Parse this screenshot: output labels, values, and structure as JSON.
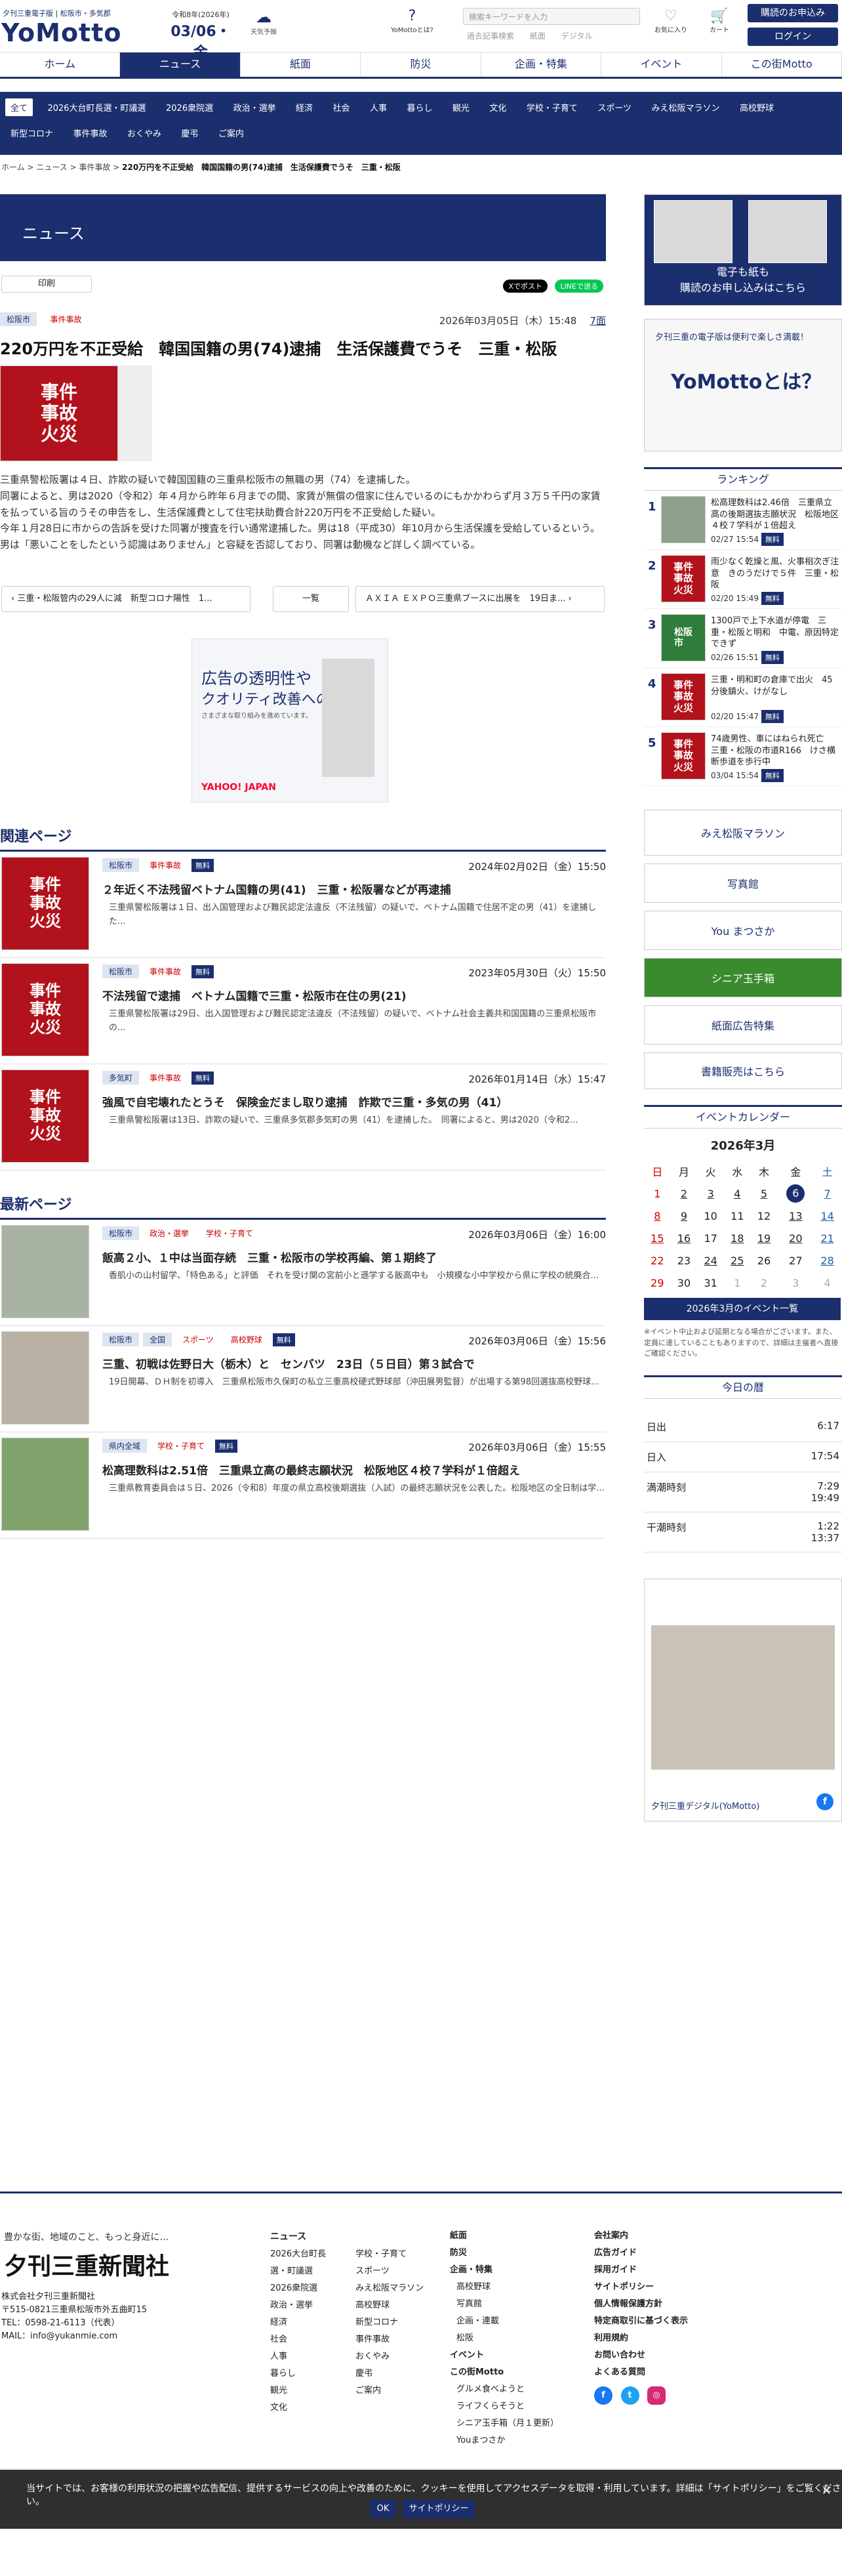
{
  "header": {
    "logo_tagline": "夕刊三重電子版 | 松阪市・多気郡",
    "logo": "YoMotto",
    "date_era": "令和8年(2026年)",
    "date_main": "03/06・金",
    "weather_label": "天気予報",
    "what_label": "YoMottoとは?",
    "search_placeholder": "検索キーワードを入力",
    "search_links": [
      "過去記事検索",
      "紙面",
      "デジタル"
    ],
    "favorites_label": "お気に入り",
    "cart_label": "カート",
    "subscribe_btn": "購読のお申込み",
    "login_btn": "ログイン"
  },
  "mainnav": [
    "ホーム",
    "ニュース",
    "紙面",
    "防災",
    "企画・特集",
    "イベント",
    "この街Motto"
  ],
  "subnav": [
    "全て",
    "2026大台町長選・町議選",
    "2026衆院選",
    "政治・選挙",
    "経済",
    "社会",
    "人事",
    "暮らし",
    "観光",
    "文化",
    "学校・子育て",
    "スポーツ",
    "みえ松阪マラソン",
    "高校野球",
    "新型コロナ",
    "事件事故",
    "おくやみ",
    "慶弔",
    "ご案内"
  ],
  "breadcrumb": {
    "items": [
      "ホーム",
      "ニュース",
      "事件事故"
    ],
    "current": "220万円を不正受給　韓国国籍の男(74)逮捕　生活保護費でうそ　三重・松阪"
  },
  "section_title": "ニュース",
  "print_label": "印刷",
  "share": {
    "x": "Xでポスト",
    "line": "LINEで送る"
  },
  "article": {
    "area_tag": "松阪市",
    "cat_tag": "事件事故",
    "date": "2026年03月05日（木）15:48",
    "page": "7面",
    "title": "220万円を不正受給　韓国国籍の男(74)逮捕　生活保護費でうそ　三重・松阪",
    "thumb_text": "事件\n事故\n火災",
    "body": [
      "三重県警松阪署は４日、詐欺の疑いで韓国国籍の三重県松阪市の無職の男（74）を逮捕した。",
      "同署によると、男は2020（令和2）年４月から昨年６月までの間、家賃が無償の借家に住んでいるのにもかかわらず月３万５千円の家賃を払っている旨のうその申告をし、生活保護費として住宅扶助費合計220万円を不正受給した疑い。",
      "今年１月28日に市からの告訴を受けた同署が捜査を行い通常逮捕した。男は18（平成30）年10月から生活保護を受給しているという。",
      "男は「悪いことをしたという認識はありません」と容疑を否認しており、同署は動機など詳しく調べている。"
    ]
  },
  "pager": {
    "prev": "三重・松阪管内の29人に減　新型コロナ陽性　1...",
    "list": "一覧",
    "next": "ＡＸＩＡ ＥＸＰＯ三重県ブースに出展を　19日ま..."
  },
  "ad": {
    "line1": "広告の透明性や",
    "line2": "クオリティ改善への",
    "line3": "さまざまな取り組みを進めています。",
    "brand": "YAHOO! JAPAN"
  },
  "related": {
    "heading": "関連ページ",
    "items": [
      {
        "area": "松阪市",
        "cat": "事件事故",
        "free": "無料",
        "date": "2024年02月02日（金）15:50",
        "title": "２年近く不法残留ベトナム国籍の男(41)　三重・松阪署などが再逮捕",
        "excerpt": "三重県警松阪署は１日、出入国管理および難民認定法違反（不法残留）の疑いで、ベトナム国籍で住居不定の男（41）を逮捕した..."
      },
      {
        "area": "松阪市",
        "cat": "事件事故",
        "free": "無料",
        "date": "2023年05月30日（火）15:50",
        "title": "不法残留で逮捕　ベトナム国籍で三重・松阪市在住の男(21)",
        "excerpt": "三重県警松阪署は29日、出入国管理および難民認定法違反（不法残留）の疑いで、ベトナム社会主義共和国国籍の三重県松阪市の..."
      },
      {
        "area": "多気町",
        "cat": "事件事故",
        "free": "無料",
        "date": "2026年01月14日（水）15:47",
        "title": "強風で自宅壊れたとうそ　保険金だまし取り逮捕　詐欺で三重・多気の男（41）",
        "excerpt": "三重県警松阪署は13日、詐欺の疑いで、三重県多気郡多気町の男（41）を逮捕した。　同署によると、男は2020（令和2..."
      }
    ]
  },
  "latest": {
    "heading": "最新ページ",
    "items": [
      {
        "tags": [
          "松阪市",
          "政治・選挙",
          "学校・子育て"
        ],
        "free": "",
        "date": "2026年03月06日（金）16:00",
        "title": "飯高２小、１中は当面存続　三重・松阪市の学校再編、第１期終了",
        "excerpt": "香肌小の山村留学、「特色ある」と評価　それを受け関の宮前小と遜学する飯高中も　小規模な小中学校から県に学校の統廃合..."
      },
      {
        "tags": [
          "松阪市",
          "全国",
          "スポーツ",
          "高校野球"
        ],
        "free": "無料",
        "date": "2026年03月06日（金）15:56",
        "title": "三重、初戦は佐野日大（栃木）と　センバツ　23日（５日目）第３試合で",
        "excerpt": "19日開幕、ＤＨ制を初導入　三重県松阪市久保町の私立三重高校硬式野球部（沖田展男監督）が出場する第98回選抜高校野球..."
      },
      {
        "tags": [
          "県内全域",
          "学校・子育て"
        ],
        "free": "無料",
        "date": "2026年03月06日（金）15:55",
        "title": "松高理数科は2.51倍　三重県立高の最終志願状況　松阪地区４校７学科が１倍超え",
        "excerpt": "三重県教育委員会は５日、2026（令和8）年度の県立高校後期選抜（入試）の最終志願状況を公表した。松阪地区の全日制は学..."
      }
    ]
  },
  "sidebar": {
    "promo1_text": "電子も紙も\n購読のお申し込みはこちら",
    "promo2_line1": "夕刊三重の電子版は便利で楽しさ満載！",
    "promo2_line2": "YoMottoとは？",
    "ranking_heading": "ランキング",
    "ranking": [
      {
        "n": "1",
        "title": "松高理数科は2.46倍　三重県立高の後期選抜志願状況　松阪地区４校７学科が１倍超え",
        "date": "02/27 15:54",
        "free": "無料"
      },
      {
        "n": "2",
        "title": "雨少なく乾燥と風、火事相次ぎ注意　きのうだけで５件　三重・松阪",
        "date": "02/20 15:49",
        "free": "無料"
      },
      {
        "n": "3",
        "title": "1300戸で上下水道が停電　三重・松阪と明和　中電、原因特定できず",
        "date": "02/26 15:51",
        "free": "無料"
      },
      {
        "n": "4",
        "title": "三重・明和町の倉庫で出火　45分後鎮火、けがなし",
        "date": "02/20 15:47",
        "free": "無料"
      },
      {
        "n": "5",
        "title": "74歳男性、車にはねられ死亡　三重・松阪の市道R166　けさ横断歩道を歩行中",
        "date": "03/04 15:54",
        "free": "無料"
      }
    ],
    "banners": [
      "みえ松阪マラソン",
      "写真館",
      "You まつさか",
      "シニア玉手箱",
      "紙面広告特集",
      "書籍販売はこちら"
    ],
    "event_heading": "イベントカレンダー",
    "cal_title": "2026年3月",
    "cal_days": [
      "日",
      "月",
      "火",
      "水",
      "木",
      "金",
      "土"
    ],
    "cal_rows": [
      [
        "1",
        "2",
        "3",
        "4",
        "5",
        "6",
        "7"
      ],
      [
        "8",
        "9",
        "10",
        "11",
        "12",
        "13",
        "14"
      ],
      [
        "15",
        "16",
        "17",
        "18",
        "19",
        "20",
        "21"
      ],
      [
        "22",
        "23",
        "24",
        "25",
        "26",
        "27",
        "28"
      ],
      [
        "29",
        "30",
        "31",
        "1",
        "2",
        "3",
        "4"
      ]
    ],
    "cal_btn": "2026年3月のイベント一覧",
    "cal_note": "※イベント中止および延期となる場合がございます。また、定員に達していることもありますので、詳細は主催者へ直接ご確認ください。",
    "today_heading": "今日の暦",
    "today": [
      {
        "label": "日出",
        "value": "6:17"
      },
      {
        "label": "日入",
        "value": "17:54"
      },
      {
        "label": "満潮時刻",
        "value": "7:29\n19:49"
      },
      {
        "label": "干潮時刻",
        "value": "1:22\n13:37"
      }
    ],
    "fb_name": "夕刊三重デジタル(YoMotto)"
  },
  "footer": {
    "tagline": "豊かな街、地域のこと、もっと身近に…",
    "logo": "夕刊三重新聞社",
    "address": "株式会社夕刊三重新聞社\n〒515-0821三重県松阪市外五曲町15\nTEL：0598-21-6113（代表）\nMAIL：info@yukanmie.com",
    "col_news_head": "ニュース",
    "col_news_a": [
      "2026大台町長選・町議選",
      "2026衆院選",
      "政治・選挙",
      "経済",
      "社会",
      "人事",
      "暮らし",
      "観光",
      "文化"
    ],
    "col_news_b": [
      "学校・子育て",
      "スポーツ",
      "みえ松阪マラソン",
      "高校野球",
      "新型コロナ",
      "事件事故",
      "おくやみ",
      "慶弔",
      "ご案内"
    ],
    "col_c": [
      "紙面",
      "防災",
      "企画・特集",
      "高校野球",
      "写真館",
      "企画・連載",
      "松阪",
      "イベント",
      "この街Motto",
      "グルメ食べようと",
      "ライフくらそうと",
      "シニア玉手箱（月１更新）",
      "Youまつさか"
    ],
    "col_d": [
      "会社案内",
      "広告ガイド",
      "採用ガイド",
      "サイトポリシー",
      "個人情報保護方針",
      "特定商取引に基づく表示",
      "利用規約",
      "お問い合わせ",
      "よくある質問"
    ]
  },
  "cookie": {
    "text": "当サイトでは、お客様の利用状況の把握や広告配信、提供するサービスの向上や改善のために、クッキーを使用してアクセスデータを取得・利用しています。詳細は「サイトポリシー」をご覧ください。",
    "ok": "OK",
    "policy": "サイトポリシー"
  }
}
